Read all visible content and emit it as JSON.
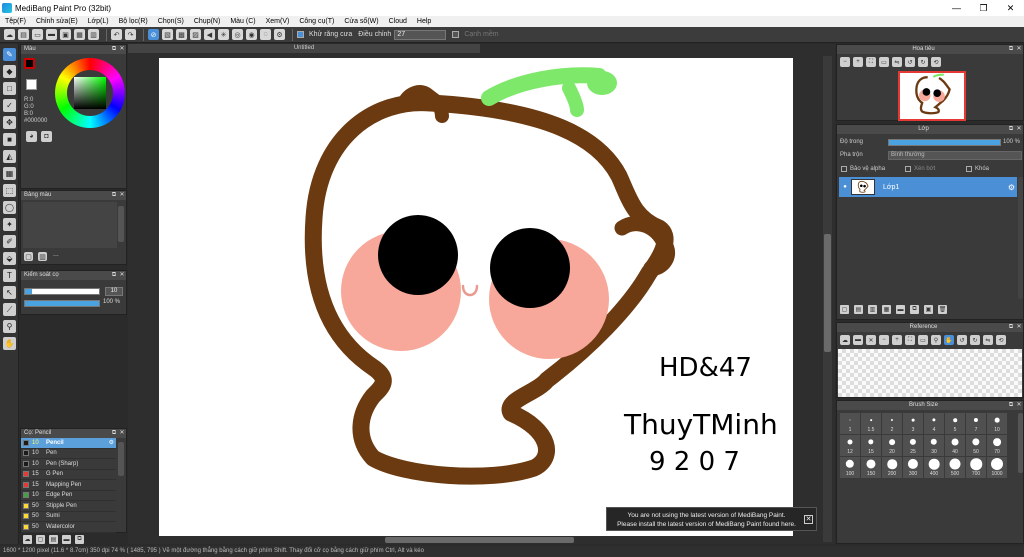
{
  "window": {
    "title": "MediBang Paint Pro (32bit)",
    "min": "—",
    "max": "❐",
    "close": "✕"
  },
  "menu": [
    "Tệp(F)",
    "Chỉnh sửa(E)",
    "Lớp(L)",
    "Bộ lọc(R)",
    "Chọn(S)",
    "Chụp(N)",
    "Màu (C)",
    "Xem(V)",
    "Công cụ(T)",
    "Cửa sổ(W)",
    "Cloud",
    "Help"
  ],
  "toolbar": {
    "antialias_label": "Khử răng cưa",
    "adjust_label": "Điều chỉnh",
    "adjust_value": "27",
    "edge_label": "Cạnh mềm"
  },
  "color_panel": {
    "title": "Màu",
    "r": "R:0",
    "g": "G:0",
    "b": "B:0",
    "hex": "#000000"
  },
  "palette_panel": {
    "title": "Bảng màu",
    "dots": "..."
  },
  "brush_control": {
    "title": "Kiểm soát cọ",
    "size_value": "10",
    "opacity_value": "100 %",
    "size_fraction": 0.1,
    "opacity_fraction": 1.0
  },
  "brush_list": {
    "title": "Cọ: Pencil",
    "items": [
      {
        "size": "10",
        "name": "Pencil",
        "color": "#1b1b1b",
        "selected": true
      },
      {
        "size": "10",
        "name": "Pen",
        "color": "#1b1b1b"
      },
      {
        "size": "10",
        "name": "Pen (Sharp)",
        "color": "#1b1b1b"
      },
      {
        "size": "15",
        "name": "G Pen",
        "color": "#e53935"
      },
      {
        "size": "15",
        "name": "Mapping Pen",
        "color": "#e53935"
      },
      {
        "size": "10",
        "name": "Edge Pen",
        "color": "#43a047"
      },
      {
        "size": "50",
        "name": "Stipple Pen",
        "color": "#fdd835"
      },
      {
        "size": "50",
        "name": "Sumi",
        "color": "#fdd835"
      },
      {
        "size": "50",
        "name": "Watercolor",
        "color": "#fdd835"
      }
    ]
  },
  "document": {
    "tab_title": "Untitled"
  },
  "canvas_text": {
    "line1": "HD&47",
    "line2": "ThuyTMinh",
    "line3": "9 2 0 7"
  },
  "notice": {
    "line1": "You are not using the latest version of MediBang Paint.",
    "line2": "Please install the latest version of MediBang Paint found here.",
    "close": "✕"
  },
  "navigator": {
    "title": "Hoa tiêu"
  },
  "layer_panel": {
    "title": "Lớp",
    "opacity_label": "Độ trong",
    "opacity_value": "100 %",
    "blend_label": "Pha trộn",
    "blend_value": "Bình thường",
    "protect_alpha": "Bảo vệ alpha",
    "clipping": "Xén bớt",
    "lock": "Khóa",
    "layer_name": "Lớp1"
  },
  "reference": {
    "title": "Reference"
  },
  "brush_size": {
    "title": "Brush Size",
    "sizes": [
      "1",
      "1.5",
      "2",
      "3",
      "4",
      "5",
      "7",
      "10",
      "12",
      "15",
      "20",
      "25",
      "30",
      "40",
      "50",
      "70",
      "100",
      "150",
      "200",
      "300",
      "400",
      "500",
      "700",
      "1000"
    ]
  },
  "status": {
    "text": "1600 * 1200 pixel   (11.6 * 8.7cm)   350 dpi   74 %   ( 1485, 795 )   Vẽ một đường thẳng bằng cách giữ phím Shift. Thay đổi cỡ cọ bằng cách giữ phím Ctrl, Alt và kéo"
  }
}
